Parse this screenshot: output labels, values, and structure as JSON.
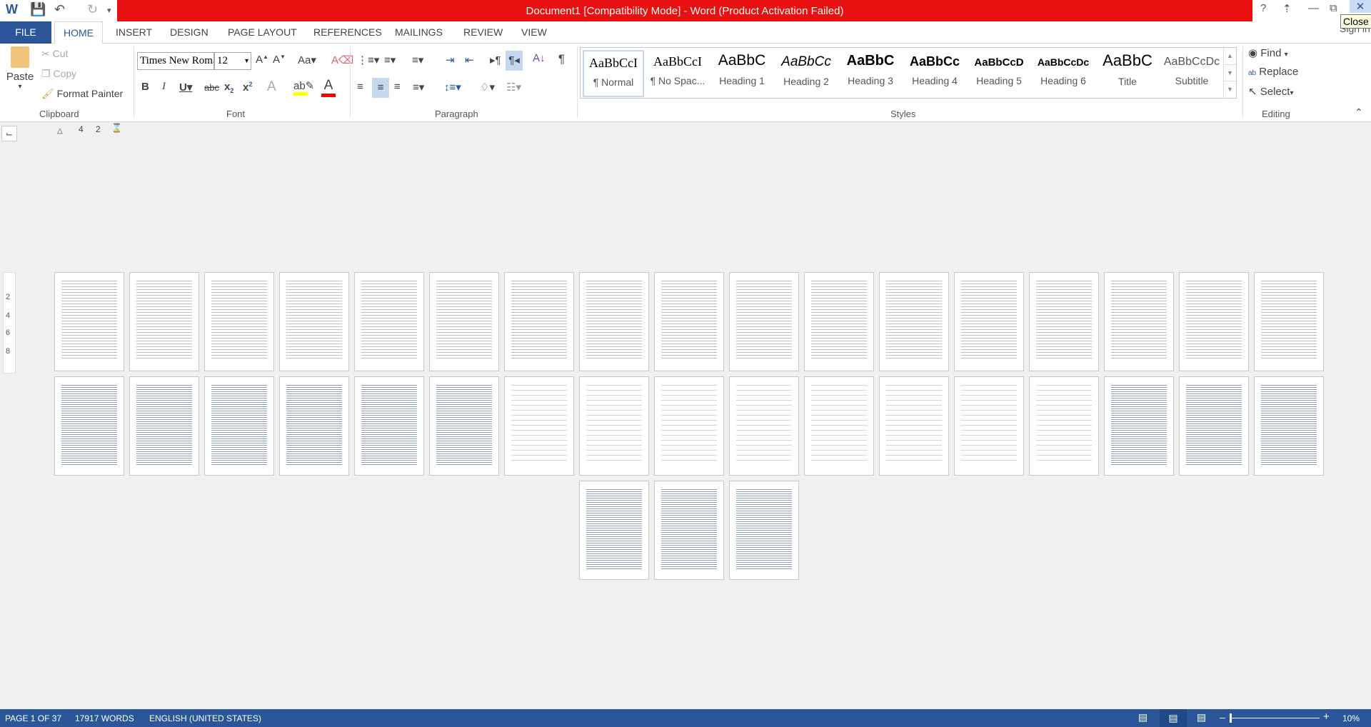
{
  "titlebar": {
    "title": "Document1 [Compatibility Mode] -  Word (Product Activation Failed)",
    "help": "?",
    "tooltip": "Close",
    "sign_in": "Sign in"
  },
  "tabs": [
    "FILE",
    "HOME",
    "INSERT",
    "DESIGN",
    "PAGE LAYOUT",
    "REFERENCES",
    "MAILINGS",
    "REVIEW",
    "VIEW"
  ],
  "clipboard": {
    "paste": "Paste",
    "cut": "Cut",
    "copy": "Copy",
    "format_painter": "Format Painter",
    "label": "Clipboard"
  },
  "font": {
    "name": "Times New Roman",
    "size": "12",
    "label": "Font",
    "highlight_color": "#ffff00",
    "font_color": "#ff0000"
  },
  "paragraph": {
    "label": "Paragraph"
  },
  "styles": {
    "label": "Styles",
    "items": [
      {
        "preview": "AaBbCcI",
        "name": "¶ Normal"
      },
      {
        "preview": "AaBbCcI",
        "name": "¶ No Spac..."
      },
      {
        "preview": "AaBbC",
        "name": "Heading 1"
      },
      {
        "preview": "AaBbCc",
        "name": "Heading 2"
      },
      {
        "preview": "AaBbC",
        "name": "Heading 3"
      },
      {
        "preview": "AaBbCc",
        "name": "Heading 4"
      },
      {
        "preview": "AaBbCcD",
        "name": "Heading 5"
      },
      {
        "preview": "AaBbCcDc",
        "name": "Heading 6"
      },
      {
        "preview": "AaBbC",
        "name": "Title"
      },
      {
        "preview": "AaBbCcDc",
        "name": "Subtitle"
      }
    ]
  },
  "editing": {
    "find": "Find",
    "replace": "Replace",
    "select": "Select",
    "label": "Editing"
  },
  "ruler": {
    "marks": [
      "4",
      "2"
    ],
    "vmarks": [
      "2",
      "4",
      "6",
      "8"
    ]
  },
  "document": {
    "page_count": 37
  },
  "status": {
    "page": "PAGE 1 OF 37",
    "words": "17917 WORDS",
    "language": "ENGLISH (UNITED STATES)",
    "zoom": "10%",
    "zoom_percent": 10
  },
  "colors": {
    "accent": "#2b579a",
    "title_bar": "#e81010"
  }
}
